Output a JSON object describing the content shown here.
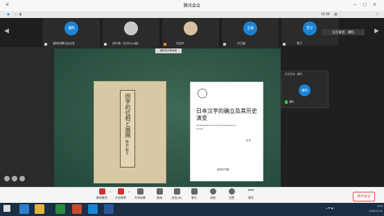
{
  "window": {
    "title": "腾讯会议",
    "time": "16:39",
    "view_mode": "演讲者视图"
  },
  "participants": [
    {
      "avatar_text": "潘昀",
      "name": "潘昀的腾讯会议室",
      "avatar_color": "#1b84d6"
    },
    {
      "avatar_text": "",
      "name": "徐尔靖（东洋2018级）",
      "avatar_color": "#c9c9c9"
    },
    {
      "avatar_text": "",
      "name": "刘笑宇",
      "avatar_color": "#d8bfa0"
    },
    {
      "avatar_text": "玉嵩",
      "name": "刘玉嵩",
      "avatar_color": "#1b84d6"
    },
    {
      "avatar_text": "雪子",
      "name": "雪子",
      "avatar_color": "#1b84d6"
    }
  ],
  "speaking_badge": "正在讲话：潘昀",
  "share_label": "潘昀的共享画面",
  "speaker_panel": {
    "header": "正在讲话：潘昀",
    "avatar_text": "潘昀",
    "name": "潘昀"
  },
  "books": {
    "left_title": "国字的位相と展開",
    "left_author": "新井 聡子",
    "right_title": "日本汉字的确立及其历史演变",
    "right_subtitle": "The Establishment and Historical Evolution of Kanji",
    "right_author": "陈 著",
    "right_publisher": "商务印书馆"
  },
  "toolbar": [
    {
      "label": "解除静音",
      "icon": "mic-icon"
    },
    {
      "label": "开启视频",
      "icon": "camera-icon"
    },
    {
      "label": "共享屏幕",
      "icon": "screen-share-icon"
    },
    {
      "label": "邀请",
      "icon": "invite-icon"
    },
    {
      "label": "成员(30)",
      "icon": "members-icon"
    },
    {
      "label": "聊天",
      "icon": "chat-icon"
    },
    {
      "label": "录制",
      "icon": "record-icon"
    },
    {
      "label": "设置",
      "icon": "settings-icon"
    },
    {
      "label": "更多",
      "icon": "more-icon"
    }
  ],
  "leave_button": "离开会议",
  "taskbar": {
    "clock_time": "9:05",
    "clock_date": "2020/11/15"
  }
}
